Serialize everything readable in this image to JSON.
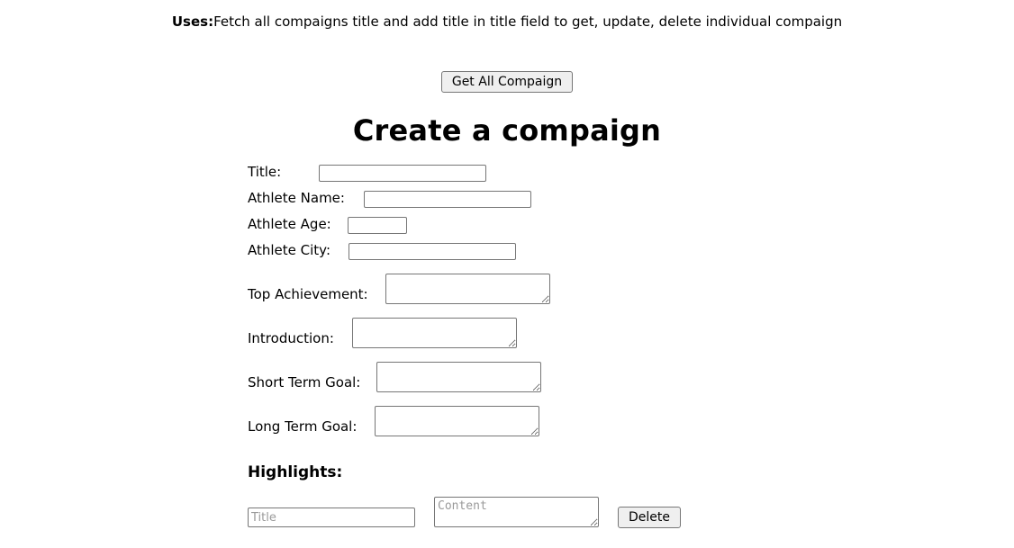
{
  "header": {
    "uses_label": "Uses:",
    "uses_text": "Fetch all compaigns title and add title in title field to get, update, delete individual compaign"
  },
  "toolbar": {
    "get_all_label": "Get All Compaign"
  },
  "page": {
    "title": "Create a compaign"
  },
  "form": {
    "fields": [
      {
        "label": "Title:",
        "value": "",
        "placeholder": "",
        "type": "text"
      },
      {
        "label": "Athlete Name:",
        "value": "",
        "placeholder": "",
        "type": "text"
      },
      {
        "label": "Athlete Age:",
        "value": "",
        "placeholder": "",
        "type": "text"
      },
      {
        "label": "Athlete City:",
        "value": "",
        "placeholder": "",
        "type": "text"
      },
      {
        "label": "Top Achievement:",
        "value": "",
        "placeholder": "",
        "type": "textarea"
      },
      {
        "label": "Introduction:",
        "value": "",
        "placeholder": "",
        "type": "textarea"
      },
      {
        "label": "Short Term Goal:",
        "value": "",
        "placeholder": "",
        "type": "textarea"
      },
      {
        "label": "Long Term Goal:",
        "value": "",
        "placeholder": "",
        "type": "textarea"
      }
    ]
  },
  "highlights": {
    "section_title": "Highlights:",
    "rows": [
      {
        "title_value": "",
        "title_placeholder": "Title",
        "content_value": "",
        "content_placeholder": "Content",
        "delete_label": "Delete"
      }
    ]
  },
  "colors": {
    "background": "#ffffff",
    "text": "#000000",
    "border": "#767676",
    "button_face": "#efefef",
    "placeholder": "#9a9a9a"
  }
}
